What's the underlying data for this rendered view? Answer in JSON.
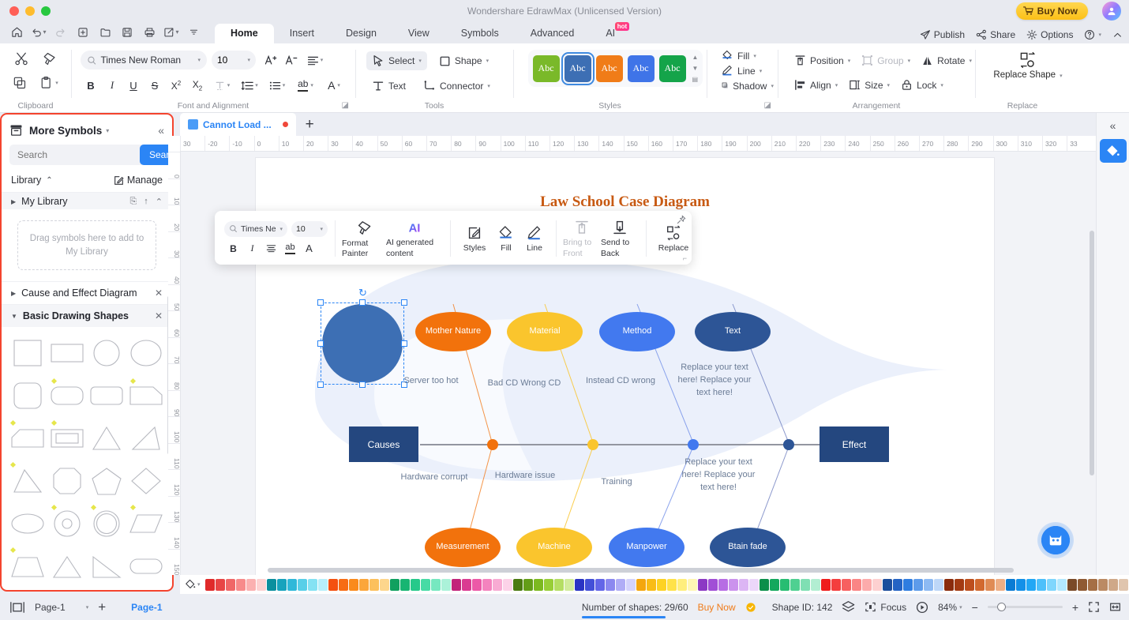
{
  "window": {
    "title": "Wondershare EdrawMax (Unlicensed Version)",
    "buy_now": "Buy Now"
  },
  "menu": {
    "tabs": [
      "Home",
      "Insert",
      "Design",
      "View",
      "Symbols",
      "Advanced",
      "AI"
    ],
    "active_tab": "Home",
    "ai_badge": "hot",
    "right_items": [
      "Publish",
      "Share",
      "Options"
    ]
  },
  "ribbon": {
    "groups": [
      "Clipboard",
      "Font and Alignment",
      "Tools",
      "Styles",
      "Arrangement",
      "Replace"
    ],
    "font_name": "Times New Roman",
    "font_size": "10",
    "tools": {
      "select": "Select",
      "shape": "Shape",
      "text": "Text",
      "connector": "Connector"
    },
    "styles_swatches": [
      "Abc",
      "Abc",
      "Abc",
      "Abc",
      "Abc"
    ],
    "styles_colors": [
      "#7ab929",
      "#3d6fb4",
      "#f07c18",
      "#3f74e8",
      "#14a44a"
    ],
    "styles_active_index": 1,
    "fill": "Fill",
    "line": "Line",
    "shadow": "Shadow",
    "position": "Position",
    "group": "Group",
    "rotate": "Rotate",
    "align": "Align",
    "size": "Size",
    "lock": "Lock",
    "replace_shape": "Replace Shape"
  },
  "left_panel": {
    "title": "More Symbols",
    "search_placeholder": "Search",
    "search_button": "Search",
    "library_label": "Library",
    "manage_label": "Manage",
    "my_library": "My Library",
    "drop_hint": "Drag symbols here to add to My Library",
    "sections": [
      {
        "label": "Cause and Effect Diagram",
        "expanded": false
      },
      {
        "label": "Basic Drawing Shapes",
        "expanded": true
      }
    ]
  },
  "doc": {
    "tab_name": "Cannot Load ...",
    "ruler_h": [
      "30",
      "-20",
      "-10",
      "0",
      "10",
      "20",
      "30",
      "40",
      "50",
      "60",
      "70",
      "80",
      "90",
      "100",
      "110",
      "120",
      "130",
      "140",
      "150",
      "160",
      "170",
      "180",
      "190",
      "200",
      "210",
      "220",
      "230",
      "240",
      "250",
      "260",
      "270",
      "280",
      "290",
      "300",
      "310",
      "320",
      "33"
    ],
    "ruler_v": [
      "0",
      "10",
      "20",
      "30",
      "40",
      "50",
      "60",
      "70",
      "80",
      "90",
      "100",
      "110",
      "120",
      "130",
      "140",
      "150",
      "50"
    ]
  },
  "float_toolbar": {
    "font_name": "Times Ne",
    "font_size": "10",
    "items": [
      {
        "label": "Format Painter",
        "icon": "format-painter-icon",
        "disabled": false
      },
      {
        "label": "AI generated content",
        "icon": "ai-icon",
        "disabled": false
      },
      {
        "label": "Styles",
        "icon": "styles-icon",
        "disabled": false
      },
      {
        "label": "Fill",
        "icon": "fill-icon",
        "disabled": false
      },
      {
        "label": "Line",
        "icon": "line-icon",
        "disabled": false
      },
      {
        "label": "Bring to Front",
        "icon": "bring-front-icon",
        "disabled": true
      },
      {
        "label": "Send to Back",
        "icon": "send-back-icon",
        "disabled": false
      },
      {
        "label": "Replace",
        "icon": "replace-icon",
        "disabled": false
      }
    ]
  },
  "diagram": {
    "title": "Law School Case Diagram",
    "cause_box": "Causes",
    "effect_box": "Effect",
    "top_nodes": [
      {
        "label": "Mother Nature",
        "color": "#f2720c"
      },
      {
        "label": "Material",
        "color": "#fac52d"
      },
      {
        "label": "Method",
        "color": "#4279ef"
      },
      {
        "label": "Text",
        "color": "#2d5596"
      }
    ],
    "bottom_nodes": [
      {
        "label": "Measurement",
        "color": "#f2720c"
      },
      {
        "label": "Machine",
        "color": "#fac52d"
      },
      {
        "label": "Manpower",
        "color": "#4279ef"
      },
      {
        "label": "Btain fade",
        "color": "#2d5596"
      }
    ],
    "top_annotations": [
      "Server too hot",
      "Bad CD Wrong CD",
      "Instead CD wrong",
      "Replace your text here! Replace your text here!"
    ],
    "bottom_annotations": [
      "Hardware corrupt",
      "Hardware issue",
      "Training",
      "Replace your text here! Replace your text here!"
    ]
  },
  "status": {
    "page_select": "Page-1",
    "page_tab": "Page-1",
    "shapes_count": "Number of shapes: 29/60",
    "buy_now": "Buy Now",
    "shape_id": "Shape ID: 142",
    "focus": "Focus",
    "zoom": "84%"
  },
  "colors": {
    "accent": "#2b85f5",
    "highlight_border": "#f4442e",
    "palette": [
      "#e02a2a",
      "#e84545",
      "#f06767",
      "#f78a8a",
      "#fbb0b0",
      "#fdd2d2",
      "#0b8f9e",
      "#17a3bd",
      "#2fb8d9",
      "#58cfe8",
      "#84e2f3",
      "#b7effa",
      "#f4500f",
      "#f76c14",
      "#fa8a1c",
      "#fba63a",
      "#fcc05c",
      "#fdd68c",
      "#10a05f",
      "#17b572",
      "#26c98a",
      "#47dba5",
      "#76e8c0",
      "#abf2d9",
      "#c2247a",
      "#da3b91",
      "#ec59a7",
      "#f483be",
      "#f8abd3",
      "#fcd2e8",
      "#4b7a11",
      "#639d17",
      "#7cb91f",
      "#98ce37",
      "#b5de63",
      "#d2ec9b",
      "#2a34c4",
      "#4350d8",
      "#6366e8",
      "#8b88f0",
      "#b0adf6",
      "#d4d3fb",
      "#f4a60d",
      "#f9bc16",
      "#fdd224",
      "#ffe24a",
      "#ffee7d",
      "#fff6b5",
      "#8c39c4",
      "#a14ed6",
      "#b76ce4",
      "#cb92ed",
      "#dcb5f4",
      "#ecd7fa",
      "#0b8f4a",
      "#14a85d",
      "#27bd72",
      "#4fd091",
      "#7fdfb3",
      "#b2eed2",
      "#ef1d1d",
      "#f43e3e",
      "#f76060",
      "#fa8585",
      "#fcabab",
      "#fdd0d0",
      "#1c4d9c",
      "#2463c4",
      "#2f7de0",
      "#5d9bea",
      "#8dbaf3",
      "#bdd7f8",
      "#8a2b0c",
      "#a33a12",
      "#bd4e1d",
      "#d2692f",
      "#e08b55",
      "#eeae85",
      "#0a7bd4",
      "#1490e8",
      "#22a7f5",
      "#4dc0fb",
      "#7fd6fd",
      "#b3e8fe",
      "#7a4a28",
      "#8f5a33",
      "#a56f45",
      "#bb8a63",
      "#cfa888",
      "#e0c5ae",
      "#7c7c78",
      "#96968f",
      "#b0b0a7",
      "#c9c9c0",
      "#dedcd2",
      "#f2efe4",
      "#111111",
      "#2a2a2a",
      "#444444",
      "#5e5e5e",
      "#7a7a7a",
      "#9a9a9a",
      "#b6b6b6",
      "#d0d0d0",
      "#e6e6e6",
      "#f5f5f5",
      "#fbfbfb",
      "#ffffff"
    ]
  }
}
